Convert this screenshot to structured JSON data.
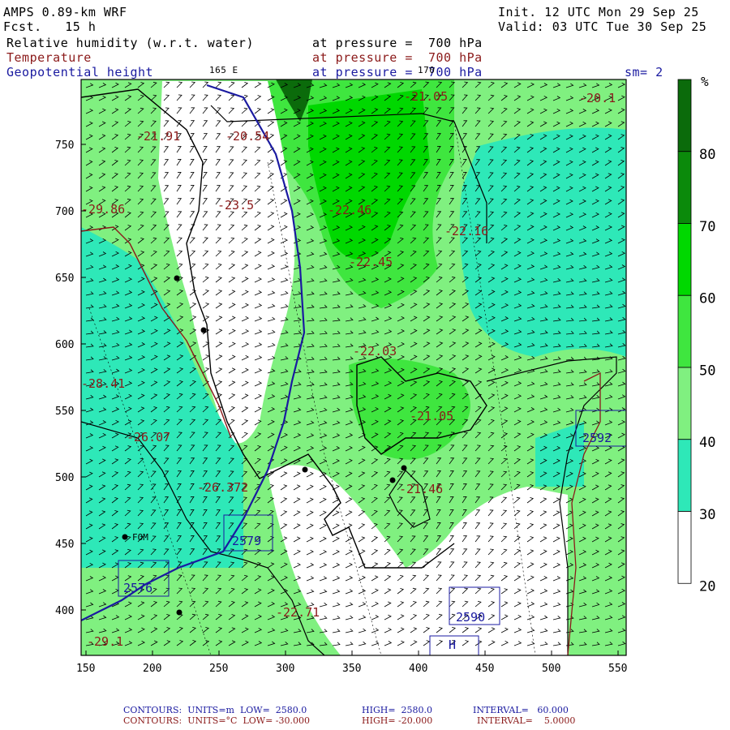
{
  "header": {
    "model": "AMPS 0.89-km WRF",
    "fcst": "Fcst.   15 h",
    "init": "Init. 12 UTC Mon 29 Sep 25",
    "valid": "Valid: 03 UTC Tue 30 Sep 25",
    "field1": "Relative humidity (w.r.t. water)",
    "field1_level": "at pressure =  700 hPa",
    "field2": "Temperature",
    "field2_level": "at pressure =  700 hPa",
    "field3": "Geopotential height",
    "field3_level": "at pressure =  700 hPa",
    "lon_label_left": "165 E",
    "lon_label_mid": "170",
    "smoothing": "sm= 2"
  },
  "axes": {
    "x_ticks": [
      "150",
      "200",
      "250",
      "300",
      "350",
      "400",
      "450",
      "500",
      "550"
    ],
    "y_ticks": [
      "750",
      "700",
      "650",
      "600",
      "550",
      "500",
      "450",
      "400"
    ]
  },
  "colorbar": {
    "unit": "%",
    "labels": [
      "80",
      "70",
      "60",
      "50",
      "40",
      "30",
      "20"
    ],
    "colors": [
      "#0b6b0b",
      "#0b8a0b",
      "#00d800",
      "#3fe63f",
      "#80f080",
      "#2ee8b8",
      "#ffffff"
    ]
  },
  "temp_labels": [
    {
      "t": "-21.91"
    },
    {
      "t": "-20.54"
    },
    {
      "t": "-21.05"
    },
    {
      "t": "-20.1"
    },
    {
      "t": "-23.5"
    },
    {
      "t": "-22.46"
    },
    {
      "t": "-22.16"
    },
    {
      "t": "-22.45"
    },
    {
      "t": "-22.03"
    },
    {
      "t": "-21.05"
    },
    {
      "t": "-26.07"
    },
    {
      "t": "-26.372"
    },
    {
      "t": "-21.46"
    },
    {
      "t": "-22.71"
    },
    {
      "t": "-29.1"
    },
    {
      "t": "-28.41"
    },
    {
      "t": "-29.86"
    }
  ],
  "height_boxes": [
    {
      "t": "2579"
    },
    {
      "t": "2576"
    },
    {
      "t": "2590"
    },
    {
      "t": "2592"
    },
    {
      "t": "H"
    }
  ],
  "station": "FOM",
  "footer": {
    "line1_a": "CONTOURS:  UNITS=m  LOW=  2580.0",
    "line1_b": "HIGH=  2580.0",
    "line1_c": "INTERVAL=   60.000",
    "line2_a": "CONTOURS:  UNITS=°C  LOW= -30.000",
    "line2_b": "HIGH= -20.000",
    "line2_c": "INTERVAL=    5.0000"
  }
}
